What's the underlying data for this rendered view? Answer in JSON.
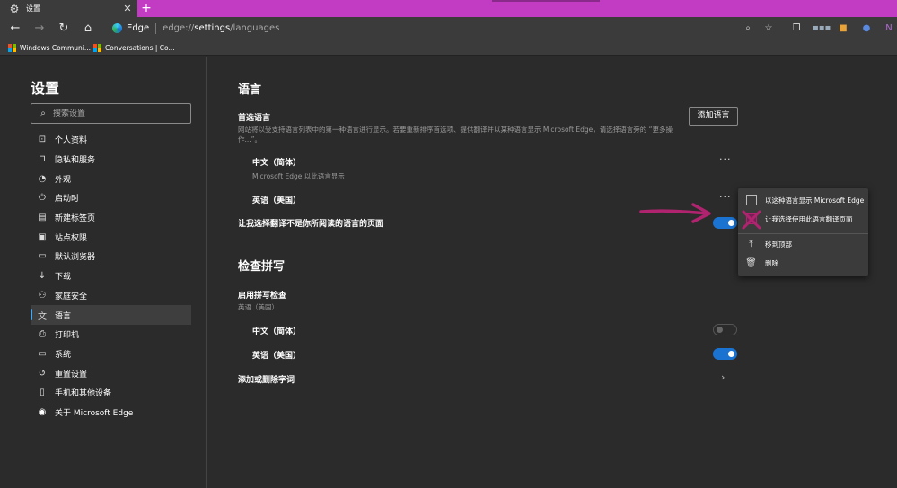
{
  "colors": {
    "titlebar": "#c23cc3",
    "accent": "#1a73d0",
    "annotation": "#b0236e"
  },
  "tab": {
    "title": "设置",
    "icon": "gear-icon",
    "close": "✕",
    "new": "+"
  },
  "address": {
    "edge_label": "Edge",
    "url_prefix": "edge://",
    "url_bold": "settings",
    "url_suffix": "/languages"
  },
  "favorites": [
    {
      "label": "Windows Communi..."
    },
    {
      "label": "Conversations | Co..."
    }
  ],
  "sidebar": {
    "title": "设置",
    "search_placeholder": "搜索设置",
    "items": [
      {
        "label": "个人资料",
        "icon": "profile-icon"
      },
      {
        "label": "隐私和服务",
        "icon": "lock-icon"
      },
      {
        "label": "外观",
        "icon": "appearance-icon"
      },
      {
        "label": "启动时",
        "icon": "power-icon"
      },
      {
        "label": "新建标签页",
        "icon": "newtab-icon"
      },
      {
        "label": "站点权限",
        "icon": "site-permissions-icon"
      },
      {
        "label": "默认浏览器",
        "icon": "browser-icon"
      },
      {
        "label": "下载",
        "icon": "download-icon"
      },
      {
        "label": "家庭安全",
        "icon": "family-icon"
      },
      {
        "label": "语言",
        "icon": "language-icon",
        "active": true
      },
      {
        "label": "打印机",
        "icon": "printer-icon"
      },
      {
        "label": "系统",
        "icon": "system-icon"
      },
      {
        "label": "重置设置",
        "icon": "reset-icon"
      },
      {
        "label": "手机和其他设备",
        "icon": "phone-icon"
      },
      {
        "label": "关于 Microsoft Edge",
        "icon": "edge-logo-icon"
      }
    ]
  },
  "main": {
    "language_heading": "语言",
    "preferred_heading": "首选语言",
    "preferred_desc": "网站将以受支持语言列表中的第一种语言进行显示。若要重新排序首选项、提供翻译并以某种语言显示 Microsoft Edge，请选择语言旁的 “更多操作...”。",
    "add_language_button": "添加语言",
    "languages": [
      {
        "name": "中文（简体）",
        "sub": "Microsoft Edge 以此语言显示"
      },
      {
        "name": "英语（美国）",
        "sub": ""
      }
    ],
    "offer_translate_label": "让我选择翻译不是你所阅读的语言的页面",
    "offer_translate_on": true,
    "spell_heading": "检查拼写",
    "spell_enable_label": "启用拼写检查",
    "spell_enable_sub": "英语（美国）",
    "spell_languages": [
      {
        "name": "中文（简体）",
        "on": false
      },
      {
        "name": "英语（美国）",
        "on": true
      }
    ],
    "custom_words_label": "添加或删除字词"
  },
  "context_menu": {
    "items": [
      {
        "label": "以这种语言显示 Microsoft Edge",
        "type": "checkbox",
        "checked": false
      },
      {
        "label": "让我选择使用此语言翻译页面",
        "type": "checkbox",
        "checked": false
      },
      {
        "label": "移到顶部",
        "type": "action",
        "icon": "move-top-icon"
      },
      {
        "label": "删除",
        "type": "action",
        "icon": "trash-icon"
      }
    ]
  }
}
